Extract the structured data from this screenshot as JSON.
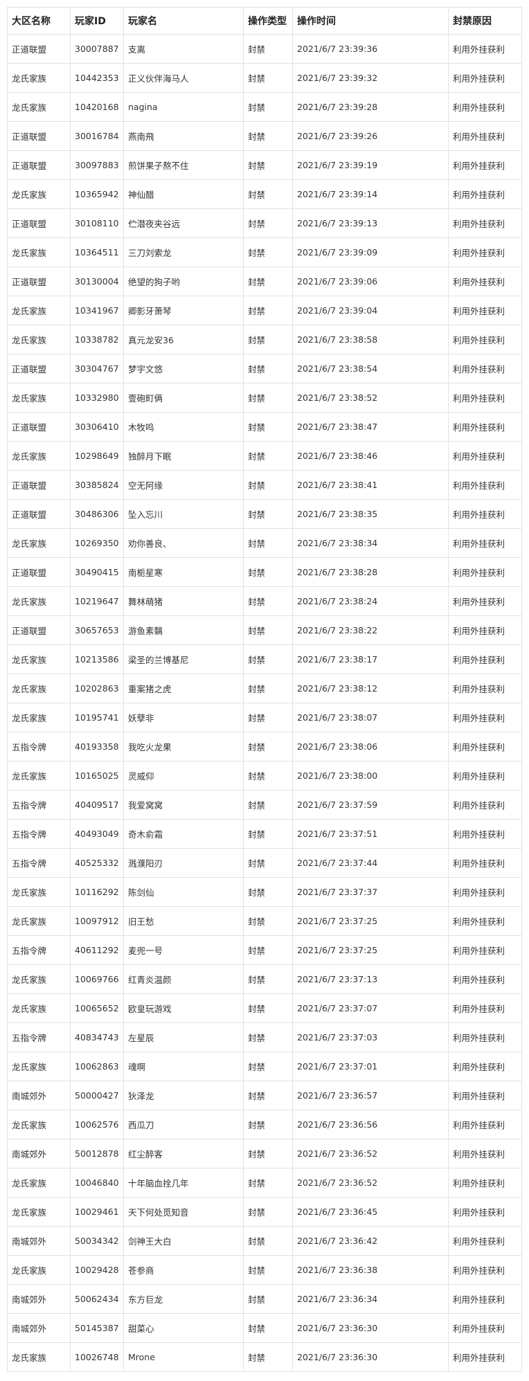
{
  "table": {
    "headers": [
      "大区名称",
      "玩家ID",
      "玩家名",
      "操作类型",
      "操作时间",
      "封禁原因"
    ],
    "rows": [
      [
        "正道联盟",
        "30007887",
        "支离",
        "封禁",
        "2021/6/7 23:39:36",
        "利用外挂获利"
      ],
      [
        "龙氏家族",
        "10442353",
        "正义伙伴海马人",
        "封禁",
        "2021/6/7 23:39:32",
        "利用外挂获利"
      ],
      [
        "龙氏家族",
        "10420168",
        "nagina",
        "封禁",
        "2021/6/7 23:39:28",
        "利用外挂获利"
      ],
      [
        "正道联盟",
        "30016784",
        "燕南飛",
        "封禁",
        "2021/6/7 23:39:26",
        "利用外挂获利"
      ],
      [
        "正道联盟",
        "30097883",
        "煎饼果子熬不住",
        "封禁",
        "2021/6/7 23:39:19",
        "利用外挂获利"
      ],
      [
        "龙氏家族",
        "10365942",
        "神仙醋",
        "封禁",
        "2021/6/7 23:39:14",
        "利用外挂获利"
      ],
      [
        "正道联盟",
        "30108110",
        "伫潜夜夹谷远",
        "封禁",
        "2021/6/7 23:39:13",
        "利用外挂获利"
      ],
      [
        "龙氏家族",
        "10364511",
        "三刀刘索龙",
        "封禁",
        "2021/6/7 23:39:09",
        "利用外挂获利"
      ],
      [
        "正道联盟",
        "30130004",
        "绝望的狗子哟",
        "封禁",
        "2021/6/7 23:39:06",
        "利用外挂获利"
      ],
      [
        "龙氏家族",
        "10341967",
        "卿影牙萧琴",
        "封禁",
        "2021/6/7 23:39:04",
        "利用外挂获利"
      ],
      [
        "龙氏家族",
        "10338782",
        "真元龙安36",
        "封禁",
        "2021/6/7 23:38:58",
        "利用外挂获利"
      ],
      [
        "正道联盟",
        "30304767",
        "梦宇文悠",
        "封禁",
        "2021/6/7 23:38:54",
        "利用外挂获利"
      ],
      [
        "龙氏家族",
        "10332980",
        "壹砲町俩",
        "封禁",
        "2021/6/7 23:38:52",
        "利用外挂获利"
      ],
      [
        "正道联盟",
        "30306410",
        "木牧鸣",
        "封禁",
        "2021/6/7 23:38:47",
        "利用外挂获利"
      ],
      [
        "龙氏家族",
        "10298649",
        "独醉月下眠",
        "封禁",
        "2021/6/7 23:38:46",
        "利用外挂获利"
      ],
      [
        "正道联盟",
        "30385824",
        "空无阿缘",
        "封禁",
        "2021/6/7 23:38:41",
        "利用外挂获利"
      ],
      [
        "正道联盟",
        "30486306",
        "坠入忘川",
        "封禁",
        "2021/6/7 23:38:35",
        "利用外挂获利"
      ],
      [
        "龙氏家族",
        "10269350",
        "劝你善良、",
        "封禁",
        "2021/6/7 23:38:34",
        "利用外挂获利"
      ],
      [
        "正道联盟",
        "30490415",
        "南栀星寒",
        "封禁",
        "2021/6/7 23:38:28",
        "利用外挂获利"
      ],
      [
        "龙氏家族",
        "10219647",
        "舞林萌猪",
        "封禁",
        "2021/6/7 23:38:24",
        "利用外挂获利"
      ],
      [
        "正道联盟",
        "30657653",
        "游鱼素黐",
        "封禁",
        "2021/6/7 23:38:22",
        "利用外挂获利"
      ],
      [
        "龙氏家族",
        "10213586",
        "梁圣的兰博基尼",
        "封禁",
        "2021/6/7 23:38:17",
        "利用外挂获利"
      ],
      [
        "龙氏家族",
        "10202863",
        "重案猪之虎",
        "封禁",
        "2021/6/7 23:38:12",
        "利用外挂获利"
      ],
      [
        "龙氏家族",
        "10195741",
        "妖孽非",
        "封禁",
        "2021/6/7 23:38:07",
        "利用外挂获利"
      ],
      [
        "五指令牌",
        "40193358",
        "我吃火龙果",
        "封禁",
        "2021/6/7 23:38:06",
        "利用外挂获利"
      ],
      [
        "龙氏家族",
        "10165025",
        "灵威仰",
        "封禁",
        "2021/6/7 23:38:00",
        "利用外挂获利"
      ],
      [
        "五指令牌",
        "40409517",
        "我爱窝窝",
        "封禁",
        "2021/6/7 23:37:59",
        "利用外挂获利"
      ],
      [
        "五指令牌",
        "40493049",
        "奇木俞霜",
        "封禁",
        "2021/6/7 23:37:51",
        "利用外挂获利"
      ],
      [
        "五指令牌",
        "40525332",
        "溅濮阳刃",
        "封禁",
        "2021/6/7 23:37:44",
        "利用外挂获利"
      ],
      [
        "龙氏家族",
        "10116292",
        "陈剑仙",
        "封禁",
        "2021/6/7 23:37:37",
        "利用外挂获利"
      ],
      [
        "龙氏家族",
        "10097912",
        "旧王愁",
        "封禁",
        "2021/6/7 23:37:25",
        "利用外挂获利"
      ],
      [
        "五指令牌",
        "40611292",
        "麦兜一号",
        "封禁",
        "2021/6/7 23:37:25",
        "利用外挂获利"
      ],
      [
        "龙氏家族",
        "10069766",
        "红青炎温颜",
        "封禁",
        "2021/6/7 23:37:13",
        "利用外挂获利"
      ],
      [
        "龙氏家族",
        "10065652",
        "欧皇玩游戏",
        "封禁",
        "2021/6/7 23:37:07",
        "利用外挂获利"
      ],
      [
        "五指令牌",
        "40834743",
        "左星辰",
        "封禁",
        "2021/6/7 23:37:03",
        "利用外挂获利"
      ],
      [
        "龙氏家族",
        "10062863",
        "魂啊",
        "封禁",
        "2021/6/7 23:37:01",
        "利用外挂获利"
      ],
      [
        "南城郊外",
        "50000427",
        "狄泽龙",
        "封禁",
        "2021/6/7 23:36:57",
        "利用外挂获利"
      ],
      [
        "龙氏家族",
        "10062576",
        "西瓜刀",
        "封禁",
        "2021/6/7 23:36:56",
        "利用外挂获利"
      ],
      [
        "南城郊外",
        "50012878",
        "红尘醉客",
        "封禁",
        "2021/6/7 23:36:52",
        "利用外挂获利"
      ],
      [
        "龙氏家族",
        "10046840",
        "十年脑血拴几年",
        "封禁",
        "2021/6/7 23:36:52",
        "利用外挂获利"
      ],
      [
        "龙氏家族",
        "10029461",
        "天下何处觅知音",
        "封禁",
        "2021/6/7 23:36:45",
        "利用外挂获利"
      ],
      [
        "南城郊外",
        "50034342",
        "剑神王大白",
        "封禁",
        "2021/6/7 23:36:42",
        "利用外挂获利"
      ],
      [
        "龙氏家族",
        "10029428",
        "苍参商",
        "封禁",
        "2021/6/7 23:36:38",
        "利用外挂获利"
      ],
      [
        "南城郊外",
        "50062434",
        "东方巨龙",
        "封禁",
        "2021/6/7 23:36:34",
        "利用外挂获利"
      ],
      [
        "南城郊外",
        "50145387",
        "甜菜心",
        "封禁",
        "2021/6/7 23:36:30",
        "利用外挂获利"
      ],
      [
        "龙氏家族",
        "10026748",
        "Mrone",
        "封禁",
        "2021/6/7 23:36:30",
        "利用外挂获利"
      ]
    ]
  }
}
